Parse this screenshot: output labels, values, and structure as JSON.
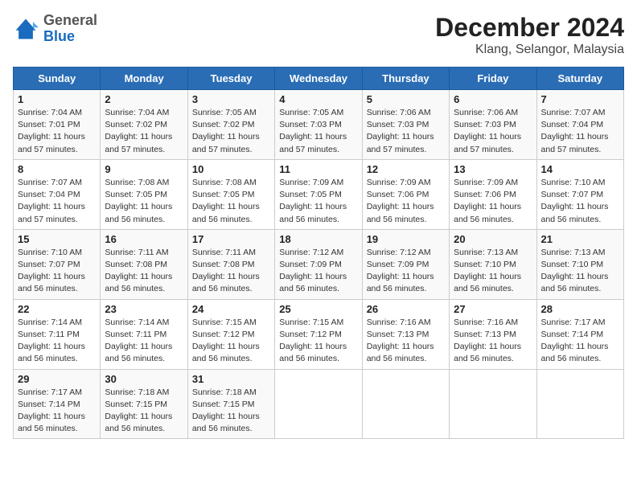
{
  "header": {
    "logo_general": "General",
    "logo_blue": "Blue",
    "month_year": "December 2024",
    "location": "Klang, Selangor, Malaysia"
  },
  "days_of_week": [
    "Sunday",
    "Monday",
    "Tuesday",
    "Wednesday",
    "Thursday",
    "Friday",
    "Saturday"
  ],
  "weeks": [
    [
      {
        "day": 1,
        "sunrise": "7:04 AM",
        "sunset": "7:01 PM",
        "daylight": "11 hours and 57 minutes."
      },
      {
        "day": 2,
        "sunrise": "7:04 AM",
        "sunset": "7:02 PM",
        "daylight": "11 hours and 57 minutes."
      },
      {
        "day": 3,
        "sunrise": "7:05 AM",
        "sunset": "7:02 PM",
        "daylight": "11 hours and 57 minutes."
      },
      {
        "day": 4,
        "sunrise": "7:05 AM",
        "sunset": "7:03 PM",
        "daylight": "11 hours and 57 minutes."
      },
      {
        "day": 5,
        "sunrise": "7:06 AM",
        "sunset": "7:03 PM",
        "daylight": "11 hours and 57 minutes."
      },
      {
        "day": 6,
        "sunrise": "7:06 AM",
        "sunset": "7:03 PM",
        "daylight": "11 hours and 57 minutes."
      },
      {
        "day": 7,
        "sunrise": "7:07 AM",
        "sunset": "7:04 PM",
        "daylight": "11 hours and 57 minutes."
      }
    ],
    [
      {
        "day": 8,
        "sunrise": "7:07 AM",
        "sunset": "7:04 PM",
        "daylight": "11 hours and 57 minutes."
      },
      {
        "day": 9,
        "sunrise": "7:08 AM",
        "sunset": "7:05 PM",
        "daylight": "11 hours and 56 minutes."
      },
      {
        "day": 10,
        "sunrise": "7:08 AM",
        "sunset": "7:05 PM",
        "daylight": "11 hours and 56 minutes."
      },
      {
        "day": 11,
        "sunrise": "7:09 AM",
        "sunset": "7:05 PM",
        "daylight": "11 hours and 56 minutes."
      },
      {
        "day": 12,
        "sunrise": "7:09 AM",
        "sunset": "7:06 PM",
        "daylight": "11 hours and 56 minutes."
      },
      {
        "day": 13,
        "sunrise": "7:09 AM",
        "sunset": "7:06 PM",
        "daylight": "11 hours and 56 minutes."
      },
      {
        "day": 14,
        "sunrise": "7:10 AM",
        "sunset": "7:07 PM",
        "daylight": "11 hours and 56 minutes."
      }
    ],
    [
      {
        "day": 15,
        "sunrise": "7:10 AM",
        "sunset": "7:07 PM",
        "daylight": "11 hours and 56 minutes."
      },
      {
        "day": 16,
        "sunrise": "7:11 AM",
        "sunset": "7:08 PM",
        "daylight": "11 hours and 56 minutes."
      },
      {
        "day": 17,
        "sunrise": "7:11 AM",
        "sunset": "7:08 PM",
        "daylight": "11 hours and 56 minutes."
      },
      {
        "day": 18,
        "sunrise": "7:12 AM",
        "sunset": "7:09 PM",
        "daylight": "11 hours and 56 minutes."
      },
      {
        "day": 19,
        "sunrise": "7:12 AM",
        "sunset": "7:09 PM",
        "daylight": "11 hours and 56 minutes."
      },
      {
        "day": 20,
        "sunrise": "7:13 AM",
        "sunset": "7:10 PM",
        "daylight": "11 hours and 56 minutes."
      },
      {
        "day": 21,
        "sunrise": "7:13 AM",
        "sunset": "7:10 PM",
        "daylight": "11 hours and 56 minutes."
      }
    ],
    [
      {
        "day": 22,
        "sunrise": "7:14 AM",
        "sunset": "7:11 PM",
        "daylight": "11 hours and 56 minutes."
      },
      {
        "day": 23,
        "sunrise": "7:14 AM",
        "sunset": "7:11 PM",
        "daylight": "11 hours and 56 minutes."
      },
      {
        "day": 24,
        "sunrise": "7:15 AM",
        "sunset": "7:12 PM",
        "daylight": "11 hours and 56 minutes."
      },
      {
        "day": 25,
        "sunrise": "7:15 AM",
        "sunset": "7:12 PM",
        "daylight": "11 hours and 56 minutes."
      },
      {
        "day": 26,
        "sunrise": "7:16 AM",
        "sunset": "7:13 PM",
        "daylight": "11 hours and 56 minutes."
      },
      {
        "day": 27,
        "sunrise": "7:16 AM",
        "sunset": "7:13 PM",
        "daylight": "11 hours and 56 minutes."
      },
      {
        "day": 28,
        "sunrise": "7:17 AM",
        "sunset": "7:14 PM",
        "daylight": "11 hours and 56 minutes."
      }
    ],
    [
      {
        "day": 29,
        "sunrise": "7:17 AM",
        "sunset": "7:14 PM",
        "daylight": "11 hours and 56 minutes."
      },
      {
        "day": 30,
        "sunrise": "7:18 AM",
        "sunset": "7:15 PM",
        "daylight": "11 hours and 56 minutes."
      },
      {
        "day": 31,
        "sunrise": "7:18 AM",
        "sunset": "7:15 PM",
        "daylight": "11 hours and 56 minutes."
      },
      null,
      null,
      null,
      null
    ]
  ]
}
